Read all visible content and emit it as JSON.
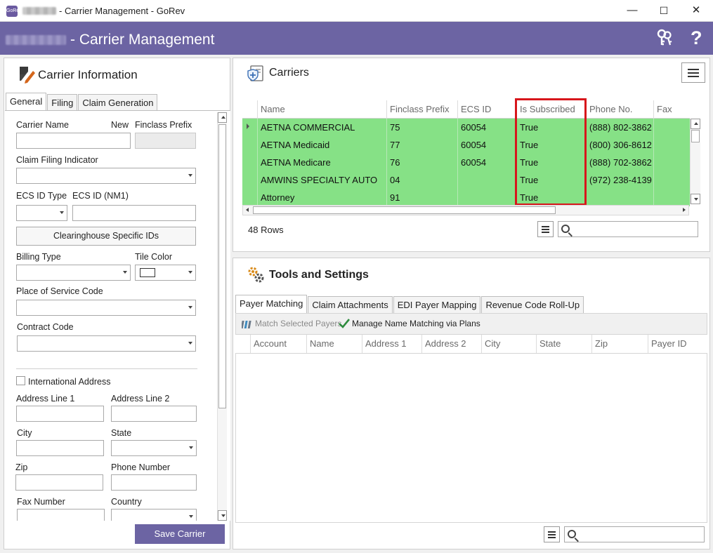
{
  "window": {
    "title": "- Carrier Management - GoRev",
    "logo_text": "GoRev",
    "minimize_glyph": "—",
    "maximize_glyph": "☐",
    "close_glyph": "✕"
  },
  "header": {
    "title": "- Carrier Management",
    "icons": [
      "keys-icon",
      "help-icon"
    ],
    "help_glyph": "?"
  },
  "carrier_info": {
    "title": "Carrier Information",
    "tabs": [
      "General",
      "Filing",
      "Claim Generation"
    ],
    "active_tab": "General",
    "fields": {
      "carrier_name": "Carrier Name",
      "new": "New",
      "finclass_prefix": "Finclass Prefix",
      "claim_filing_indicator": "Claim Filing Indicator",
      "ecs_id_type": "ECS ID Type",
      "ecs_id_nm1": "ECS ID (NM1)",
      "clearinghouse_button": "Clearinghouse Specific IDs",
      "billing_type": "Billing Type",
      "tile_color": "Tile Color",
      "place_of_service_code": "Place of Service Code",
      "contract_code": "Contract Code",
      "international_address": "International Address",
      "address_line_1": "Address Line 1",
      "address_line_2": "Address Line 2",
      "city": "City",
      "state": "State",
      "zip": "Zip",
      "phone_number": "Phone Number",
      "fax_number": "Fax Number",
      "country": "Country"
    },
    "save_button": "Save Carrier"
  },
  "carriers": {
    "title": "Carriers",
    "columns": [
      "Name",
      "Finclass Prefix",
      "ECS ID",
      "Is Subscribed",
      "Phone No.",
      "Fax"
    ],
    "rows": [
      [
        "AETNA COMMERCIAL",
        "75",
        "60054",
        "True",
        "(888) 802-3862",
        ""
      ],
      [
        "AETNA Medicaid",
        "77",
        "60054",
        "True",
        "(800) 306-8612",
        ""
      ],
      [
        "AETNA Medicare",
        "76",
        "60054",
        "True",
        "(888) 702-3862",
        ""
      ],
      [
        "AMWINS SPECIALTY AUTO",
        "04",
        "",
        "True",
        "(972) 238-4139",
        ""
      ],
      [
        "Attorney",
        "91",
        "",
        "True",
        "",
        ""
      ]
    ],
    "row_count": "48 Rows",
    "row_highlight_color": "#86e186",
    "highlight_border_color": "#d7161c"
  },
  "tools": {
    "title": "Tools and Settings",
    "tabs": [
      "Payer Matching",
      "Claim Attachments",
      "EDI Payer Mapping",
      "Revenue Code Roll-Up"
    ],
    "active_tab": "Payer Matching",
    "toolbar": {
      "match_selected": "Match Selected Payers",
      "manage_name_matching": "Manage Name Matching via Plans"
    },
    "columns": [
      "Account",
      "Name",
      "Address 1",
      "Address 2",
      "City",
      "State",
      "Zip",
      "Payer ID"
    ]
  },
  "colors": {
    "brand": "#6c64a3",
    "title_accent": "#d7161c"
  }
}
